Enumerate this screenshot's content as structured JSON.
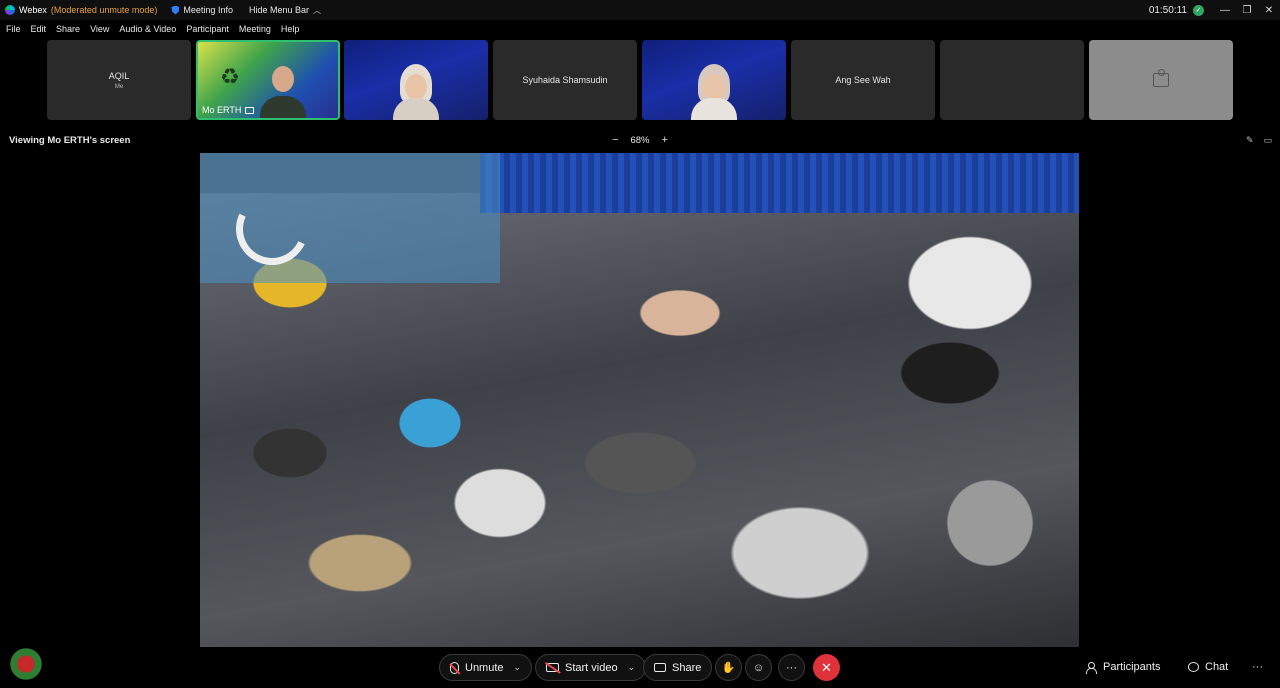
{
  "titlebar": {
    "app_name": "Webex",
    "mode": "(Moderated unmute mode)",
    "meeting_info": "Meeting Info",
    "hide_menu": "Hide Menu Bar",
    "clock": "01:50:11"
  },
  "menu": [
    "File",
    "Edit",
    "Share",
    "View",
    "Audio & Video",
    "Participant",
    "Meeting",
    "Help"
  ],
  "participants": [
    {
      "name": "AQIL",
      "sub": "Me",
      "type": "avatar"
    },
    {
      "name": "Mo ERTH",
      "type": "video-active"
    },
    {
      "name": "",
      "type": "video"
    },
    {
      "name": "Syuhaida Shamsudin",
      "type": "avatar"
    },
    {
      "name": "",
      "type": "video"
    },
    {
      "name": "Ang See Wah",
      "type": "avatar"
    },
    {
      "name": "",
      "type": "empty"
    },
    {
      "name": "",
      "type": "guest"
    }
  ],
  "viewing": {
    "label": "Viewing Mo ERTH's screen",
    "zoom": "68%"
  },
  "controls": {
    "unmute": "Unmute",
    "start_video": "Start video",
    "share": "Share",
    "participants": "Participants",
    "chat": "Chat"
  },
  "colors": {
    "active_border": "#2fbf71",
    "end_call": "#e0323a",
    "mode_text": "#e7a33e"
  }
}
